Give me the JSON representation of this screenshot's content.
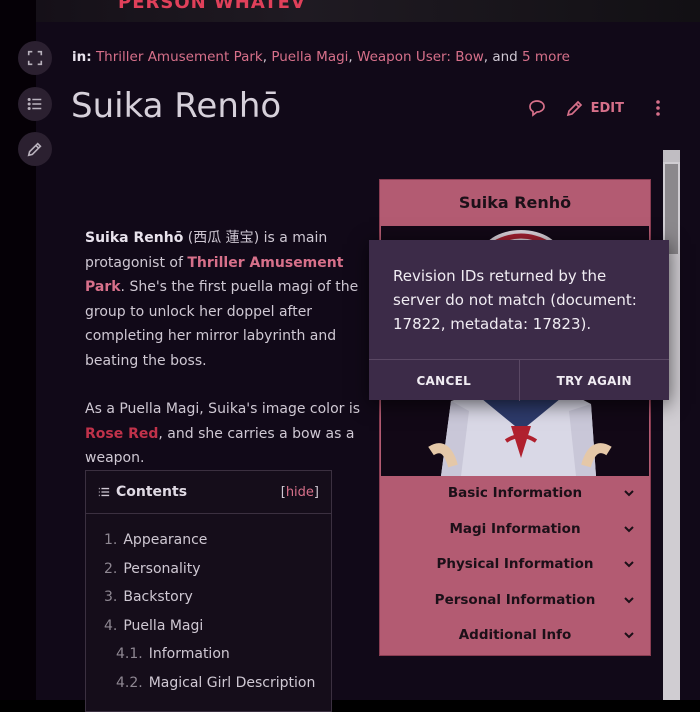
{
  "banner": {
    "text": "PERSON WHATEV"
  },
  "tools": {
    "icons": [
      "expand-icon",
      "list-icon",
      "pencil-icon"
    ]
  },
  "categories": {
    "prefix": "in:",
    "items": [
      "Thriller Amusement Park",
      "Puella Magi",
      "Weapon User: Bow"
    ],
    "separator": ", ",
    "and_text": ", and ",
    "more": "5 more"
  },
  "page": {
    "title": "Suika Renhō"
  },
  "actions": {
    "edit_label": "EDIT"
  },
  "article": {
    "p1_name": "Suika Renhō",
    "p1_native": " (西瓜 蓮宝",
    "p1_native_close": ") is a main protagonist of ",
    "p1_link": "Thriller Amusement Park",
    "p1_rest": ". She's the first puella magi of the group to unlock her doppel after completing her mirror labyrinth and beating the boss.",
    "p2_start": "As a Puella Magi, Suika's image color is ",
    "p2_color": "Rose Red",
    "p2_rest": ", and she carries a bow as a weapon."
  },
  "toc": {
    "title": "Contents",
    "hide_open": "[",
    "hide_label": "hide",
    "hide_close": "]",
    "items": [
      {
        "num": "1.",
        "label": "Appearance"
      },
      {
        "num": "2.",
        "label": "Personality"
      },
      {
        "num": "3.",
        "label": "Backstory"
      },
      {
        "num": "4.",
        "label": "Puella Magi"
      },
      {
        "num": "4.1.",
        "label": "Information"
      },
      {
        "num": "4.2.",
        "label": "Magical Girl Description"
      }
    ]
  },
  "infobox": {
    "title": "Suika Renhō",
    "sections": [
      "Basic Information",
      "Magi Information",
      "Physical Information",
      "Personal Information",
      "Additional Info"
    ],
    "accent": "#b35b72"
  },
  "dialog": {
    "message": "Revision IDs returned by the server do not match (document: 17822, metadata: 17823).",
    "cancel": "CANCEL",
    "retry": "TRY AGAIN"
  },
  "colors": {
    "link": "#d7708a",
    "rose_red": "#c0324a",
    "background": "#110918"
  }
}
